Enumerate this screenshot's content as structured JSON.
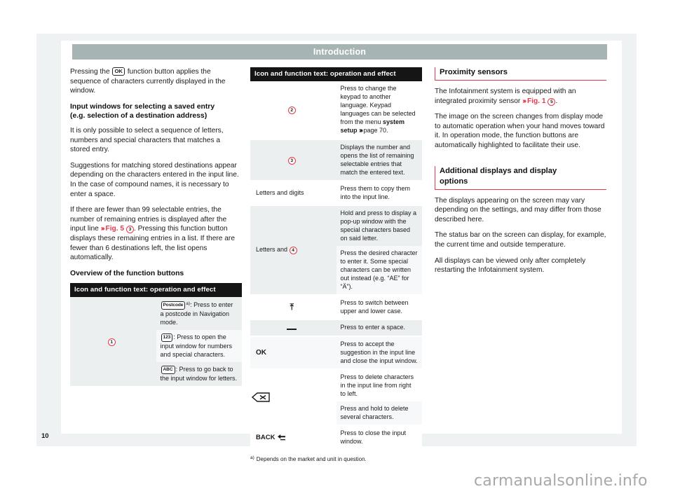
{
  "document": {
    "running_head": "Introduction",
    "page_number": "10",
    "watermark": "carmanualsonline.info"
  },
  "colors": {
    "accent_red": "#e8394a",
    "header_bar": "#a7b4b4",
    "table_header_bg": "#151515",
    "page_bg": "#eef2f2"
  },
  "column_left": {
    "para_1_before": "Pressing the ",
    "para_1_keycap": "OK",
    "para_1_after": " function button applies the sequence of characters currently displayed in the window.",
    "heading_1_line_1": "Input windows for selecting a saved entry",
    "heading_1_line_2": "(e.g. selection of a destination address)",
    "para_2": "It is only possible to select a sequence of letters, numbers and special characters that matches a stored entry.",
    "para_3": "Suggestions for matching stored destinations appear depending on the characters entered in the input line. In the case of compound names, it is necessary to enter a space.",
    "para_4_before": "If there are fewer than 99 selectable entries, the number of remaining entries is displayed after the input line ",
    "para_4_xref": "Fig. 5",
    "para_4_circle": "3",
    "para_4_after": ". Pressing this function button displays these remaining entries in a list. If there are fewer than 6 destinations left, the list opens automatically.",
    "heading_2": "Overview of the function buttons",
    "table": {
      "header": "Icon and function text: operation and effect",
      "rows": [
        {
          "icon_type": "circle-number",
          "icon_label": "1",
          "effects": [
            {
              "keycap": "Postcode",
              "footnote_marker": "a)",
              "text": ": Press to enter a postcode in Navigation mode."
            },
            {
              "keycap": "123",
              "footnote_marker": "",
              "text": ": Press to open the input window for numbers and special characters."
            },
            {
              "keycap": "ABC",
              "footnote_marker": "",
              "text": ": Press to go back to the input window for letters."
            }
          ]
        }
      ]
    }
  },
  "column_middle": {
    "table": {
      "header": "Icon and function text: operation and effect",
      "rows": [
        {
          "icon_type": "circle-number",
          "icon_label": "2",
          "effects": [
            {
              "text_before": "Press to change the keypad to another language. Keypad languages can be selected from the menu ",
              "bold_term": "system setup",
              "chevron": true,
              "text_after": " page 70."
            }
          ]
        },
        {
          "icon_type": "circle-number",
          "icon_label": "3",
          "effects": [
            {
              "text_before": "Displays the number and opens the list of remaining selectable entries that match the entered text.",
              "bold_term": "",
              "chevron": false,
              "text_after": ""
            }
          ]
        },
        {
          "icon_type": "text",
          "icon_label": "Letters and digits",
          "effects": [
            {
              "text_before": "Press them to copy them into the input line.",
              "bold_term": "",
              "chevron": false,
              "text_after": ""
            }
          ]
        },
        {
          "icon_type": "text-circle",
          "icon_label": "Letters and",
          "icon_circle": "4",
          "effects": [
            {
              "text_before": "Hold and press to display a pop-up window with the special characters based on said letter.",
              "bold_term": "",
              "chevron": false,
              "text_after": ""
            },
            {
              "text_before": "Press the desired character to enter it. Some special characters can be written out instead (e.g. “AE” for “Ä”).",
              "bold_term": "",
              "chevron": false,
              "text_after": ""
            }
          ]
        },
        {
          "icon_type": "glyph-arrow-up",
          "icon_label": "⬆",
          "effects": [
            {
              "text_before": "Press to switch between upper and lower case.",
              "bold_term": "",
              "chevron": false,
              "text_after": ""
            }
          ]
        },
        {
          "icon_type": "glyph-space",
          "icon_label": "␣",
          "effects": [
            {
              "text_before": "Press to enter a space.",
              "bold_term": "",
              "chevron": false,
              "text_after": ""
            }
          ]
        },
        {
          "icon_type": "glyph-ok",
          "icon_label": "OK",
          "effects": [
            {
              "text_before": "Press to accept the suggestion in the input line and close the input window.",
              "bold_term": "",
              "chevron": false,
              "text_after": ""
            }
          ]
        },
        {
          "icon_type": "glyph-backspace",
          "icon_label": "backspace",
          "effects": [
            {
              "text_before": "Press to delete characters in the input line from right to left.",
              "bold_term": "",
              "chevron": false,
              "text_after": ""
            },
            {
              "text_before": "Press and hold to delete several characters.",
              "bold_term": "",
              "chevron": false,
              "text_after": ""
            }
          ]
        },
        {
          "icon_type": "glyph-back",
          "icon_label": "BACK",
          "effects": [
            {
              "text_before": "Press to close the input window.",
              "bold_term": "",
              "chevron": false,
              "text_after": ""
            }
          ]
        }
      ],
      "footnote_marker": "a)",
      "footnote_text": "Depends on the market and unit in question."
    }
  },
  "column_right": {
    "section_1": {
      "heading": "Proximity sensors",
      "para_1_before": "The Infotainment system is equipped with an integrated proximity sensor ",
      "para_1_xref": "Fig. 1",
      "para_1_circle": "5",
      "para_1_after": ".",
      "para_2": "The image on the screen changes from display mode to automatic operation when your hand moves toward it. In operation mode, the function buttons are automatically highlighted to facilitate their use."
    },
    "section_2": {
      "heading_line_1": "Additional displays and display",
      "heading_line_2": "options",
      "para_1": "The displays appearing on the screen may vary depending on the settings, and may differ from those described here.",
      "para_2": "The status bar on the screen can display, for example, the current time and outside temperature.",
      "para_3": "All displays can be viewed only after completely restarting the Infotainment system."
    }
  }
}
